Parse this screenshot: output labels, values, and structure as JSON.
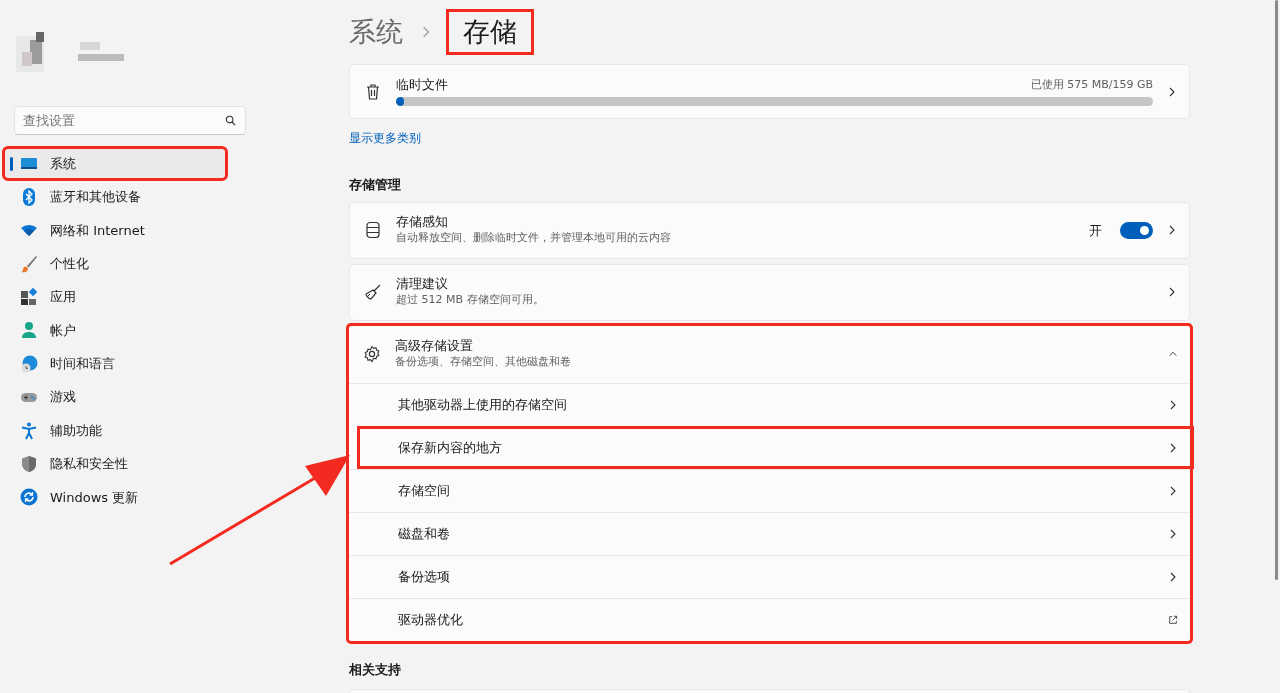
{
  "sidebar": {
    "search": {
      "placeholder": "查找设置"
    },
    "items": [
      {
        "label": "系统",
        "kind": "system",
        "selected": true,
        "highlighted": true
      },
      {
        "label": "蓝牙和其他设备",
        "kind": "bluetooth",
        "selected": false,
        "highlighted": false
      },
      {
        "label": "网络和 Internet",
        "kind": "wifi",
        "selected": false,
        "highlighted": false
      },
      {
        "label": "个性化",
        "kind": "brush",
        "selected": false,
        "highlighted": false
      },
      {
        "label": "应用",
        "kind": "apps",
        "selected": false,
        "highlighted": false
      },
      {
        "label": "帐户",
        "kind": "person",
        "selected": false,
        "highlighted": false
      },
      {
        "label": "时间和语言",
        "kind": "globe",
        "selected": false,
        "highlighted": false
      },
      {
        "label": "游戏",
        "kind": "gamepad",
        "selected": false,
        "highlighted": false
      },
      {
        "label": "辅助功能",
        "kind": "accessibility",
        "selected": false,
        "highlighted": false
      },
      {
        "label": "隐私和安全性",
        "kind": "shield",
        "selected": false,
        "highlighted": false
      },
      {
        "label": "Windows 更新",
        "kind": "update",
        "selected": false,
        "highlighted": false
      }
    ]
  },
  "breadcrumb": [
    {
      "label": "系统",
      "current": false,
      "highlighted": false
    },
    {
      "label": "存储",
      "current": true,
      "highlighted": true
    }
  ],
  "temp_files": {
    "label": "临时文件",
    "usage": "已使用 575 MB/159 GB",
    "level": 0.01
  },
  "show_more_link": "显示更多类别",
  "sections": [
    {
      "heading": "存储管理",
      "cards": [
        {
          "kind": "drive",
          "title": "存储感知",
          "subtitle": "自动释放空间、删除临时文件，并管理本地可用的云内容",
          "toggle": {
            "label": "开",
            "on": true
          }
        },
        {
          "kind": "broom",
          "title": "清理建议",
          "subtitle": "超过 512 MB 存储空间可用。"
        },
        {
          "kind": "gear",
          "title": "高级存储设置",
          "subtitle": "备份选项、存储空间、其他磁盘和卷",
          "expanded": true,
          "highlighted": true,
          "children": [
            {
              "label": "其他驱动器上使用的存储空间",
              "kind": "link",
              "highlighted": false
            },
            {
              "label": "保存新内容的地方",
              "kind": "link",
              "highlighted": true
            },
            {
              "label": "存储空间",
              "kind": "link",
              "highlighted": false
            },
            {
              "label": "磁盘和卷",
              "kind": "link",
              "highlighted": false
            },
            {
              "label": "备份选项",
              "kind": "link",
              "highlighted": false
            },
            {
              "label": "驱动器优化",
              "kind": "external",
              "highlighted": false
            }
          ]
        }
      ]
    },
    {
      "heading": "相关支持"
    }
  ],
  "pointer_arrow": true
}
